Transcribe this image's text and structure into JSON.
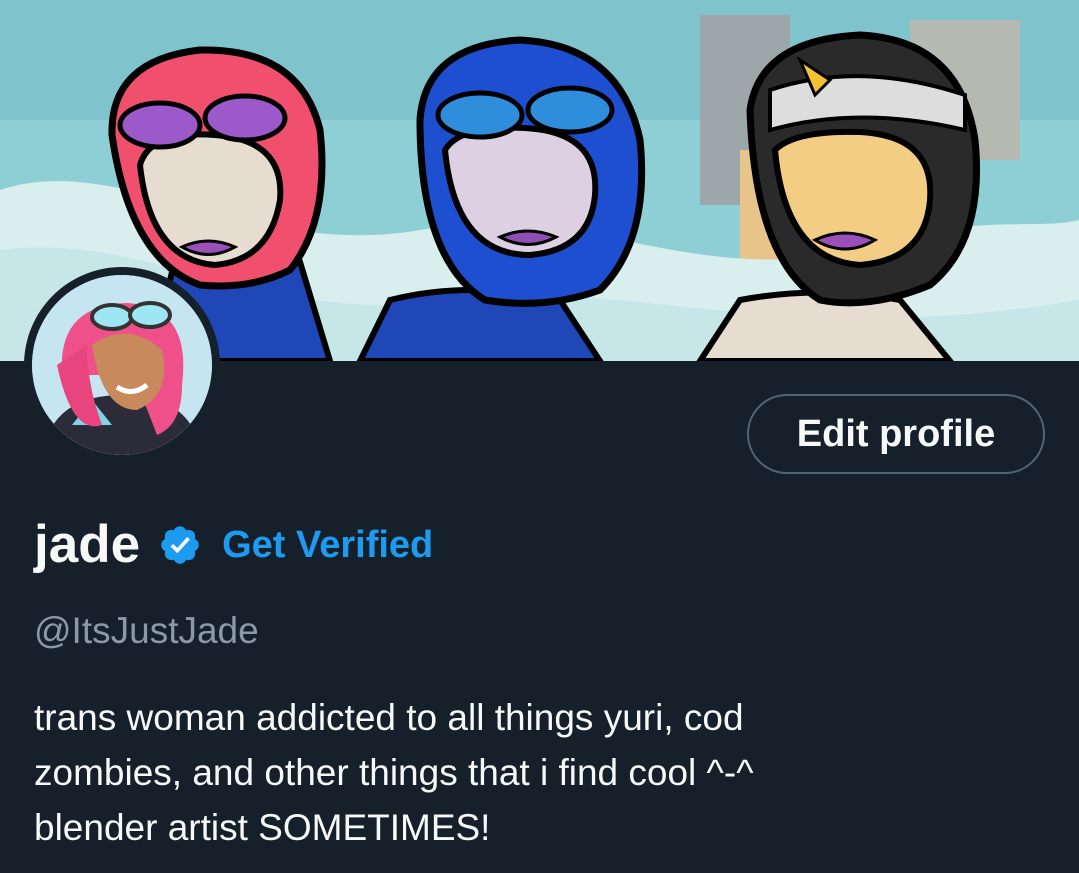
{
  "profile": {
    "display_name": "jade",
    "verified_badge_icon": "verified-badge-icon",
    "get_verified_label": "Get Verified",
    "handle": "@ItsJustJade",
    "bio": "trans woman addicted to all things yuri, cod\nzombies, and other things that i find cool ^-^\nblender artist SOMETIMES!"
  },
  "actions": {
    "edit_profile_label": "Edit profile"
  },
  "colors": {
    "background": "#15202b",
    "accent": "#1d9bf0",
    "secondary_text": "#8b98a5",
    "button_border": "#536471"
  }
}
